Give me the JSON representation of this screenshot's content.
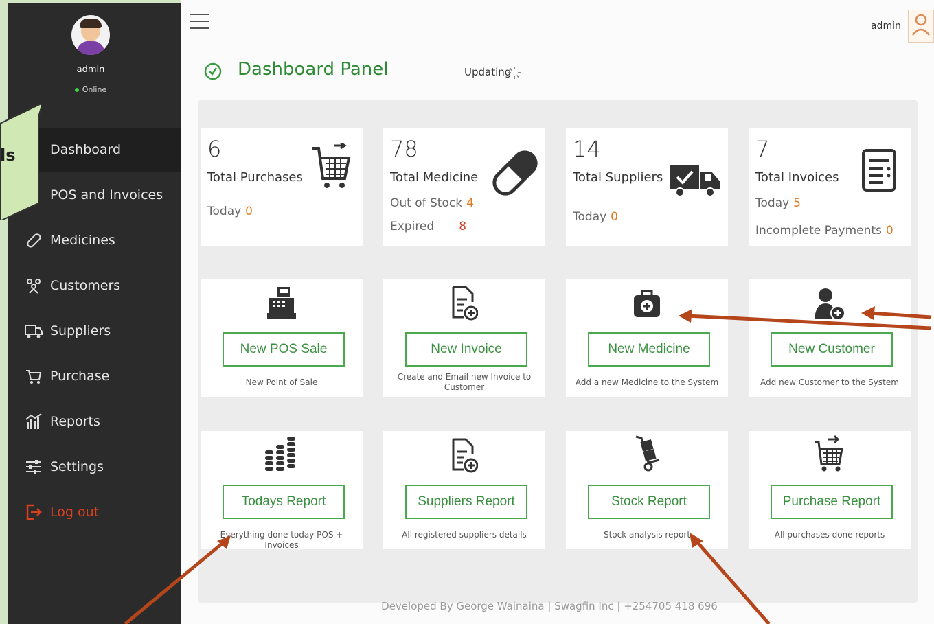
{
  "sidebar": {
    "user_name": "admin",
    "status": "Online",
    "items": [
      {
        "label": "Dashboard",
        "icon": "dashboard-icon"
      },
      {
        "label": "POS and Invoices",
        "icon": "pos-icon"
      },
      {
        "label": "Medicines",
        "icon": "pill-icon"
      },
      {
        "label": "Customers",
        "icon": "customers-icon"
      },
      {
        "label": "Suppliers",
        "icon": "truck-icon"
      },
      {
        "label": "Purchase",
        "icon": "cart-icon"
      },
      {
        "label": "Reports",
        "icon": "chart-icon"
      },
      {
        "label": "Settings",
        "icon": "sliders-icon"
      },
      {
        "label": "Log out",
        "icon": "logout-icon"
      }
    ]
  },
  "callout": {
    "text": "ls"
  },
  "header": {
    "user": "admin",
    "title": "Dashboard Panel",
    "updating": "Updating"
  },
  "stats": {
    "purchases": {
      "value": "6",
      "label": "Total Purchases",
      "today_label": "Today",
      "today_value": "0"
    },
    "medicine": {
      "value": "78",
      "label": "Total Medicine",
      "out_label": "Out of Stock",
      "out_value": "4",
      "expired_label": "Expired",
      "expired_value": "8"
    },
    "suppliers": {
      "value": "14",
      "label": "Total Suppliers",
      "today_label": "Today",
      "today_value": "0"
    },
    "invoices": {
      "value": "7",
      "label": "Total Invoices",
      "today_label": "Today",
      "today_value": "5",
      "incomplete_label": "Incomplete Payments",
      "incomplete_value": "0"
    }
  },
  "tiles": [
    {
      "button": "New POS Sale",
      "desc": "New Point of Sale",
      "icon": "cash-register-icon"
    },
    {
      "button": "New Invoice",
      "desc": "Create and Email new Invoice to Customer",
      "icon": "add-document-icon"
    },
    {
      "button": "New Medicine",
      "desc": "Add a new Medicine to the System",
      "icon": "medical-kit-icon"
    },
    {
      "button": "New Customer",
      "desc": "Add new Customer to the System",
      "icon": "add-user-icon"
    },
    {
      "button": "Todays Report",
      "desc": "Everything done today POS + Invoices",
      "icon": "coins-icon"
    },
    {
      "button": "Suppliers Report",
      "desc": "All registered suppliers details",
      "icon": "add-document-icon"
    },
    {
      "button": "Stock Report",
      "desc": "Stock analysis report",
      "icon": "hand-truck-icon"
    },
    {
      "button": "Purchase Report",
      "desc": "All purchases done reports",
      "icon": "cart-icon"
    }
  ],
  "footer": "Developed By George Wainaina | Swagfin Inc | +254705 418 696",
  "colors": {
    "accent": "#2f8a36",
    "sidebar": "#2b2b2b",
    "logout": "#d8401e",
    "arrow": "#b5451b",
    "slide_bg": "#d3e6c3"
  }
}
